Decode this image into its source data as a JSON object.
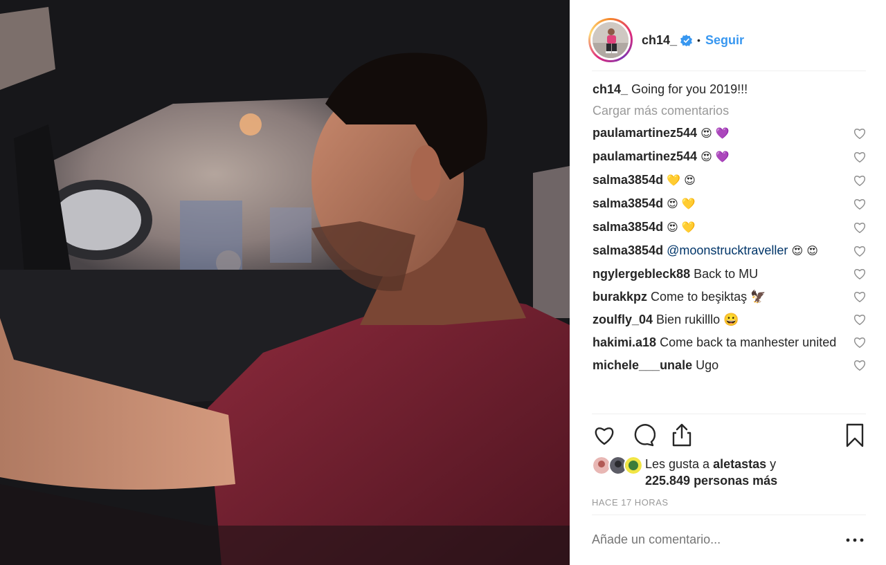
{
  "post": {
    "username": "ch14_",
    "verified": true,
    "follow_label": "Seguir",
    "dot": "•",
    "caption_user": "ch14_",
    "caption_text": "Going for you 2019!!!",
    "load_more": "Cargar más comentarios"
  },
  "comments": [
    {
      "user": "paulamartinez544",
      "text": "😍 💜"
    },
    {
      "user": "paulamartinez544",
      "text": "😍 💜"
    },
    {
      "user": "salma3854d",
      "text": "💛 😍"
    },
    {
      "user": "salma3854d",
      "text": "😍 💛"
    },
    {
      "user": "salma3854d",
      "text": "😍 💛"
    },
    {
      "user": "salma3854d",
      "mention": "@moonstrucktraveller",
      "text": "😍 😍"
    },
    {
      "user": "ngylergebleck88",
      "text": "Back to MU"
    },
    {
      "user": "burakkpz",
      "text": "Come to beşiktaş 🦅"
    },
    {
      "user": "zoulfly_04",
      "text": "Bien rukilllo 😀"
    },
    {
      "user": "hakimi.a18",
      "text": "Come back ta manhester united"
    },
    {
      "user": "michele___unale",
      "text": "Ugo"
    }
  ],
  "likes": {
    "prefix": "Les gusta a",
    "user": "aletastas",
    "conjunction": "y",
    "count_text": "225.849 personas más"
  },
  "timestamp": "HACE 17 HORAS",
  "comment_input": {
    "placeholder": "Añade un comentario..."
  },
  "colors": {
    "accent": "#3897f0",
    "muted": "#999999",
    "text": "#262626",
    "divider": "#efefef"
  },
  "icons": [
    "verified-badge-icon",
    "heart-icon",
    "comment-icon",
    "share-icon",
    "bookmark-icon",
    "more-options-icon"
  ]
}
